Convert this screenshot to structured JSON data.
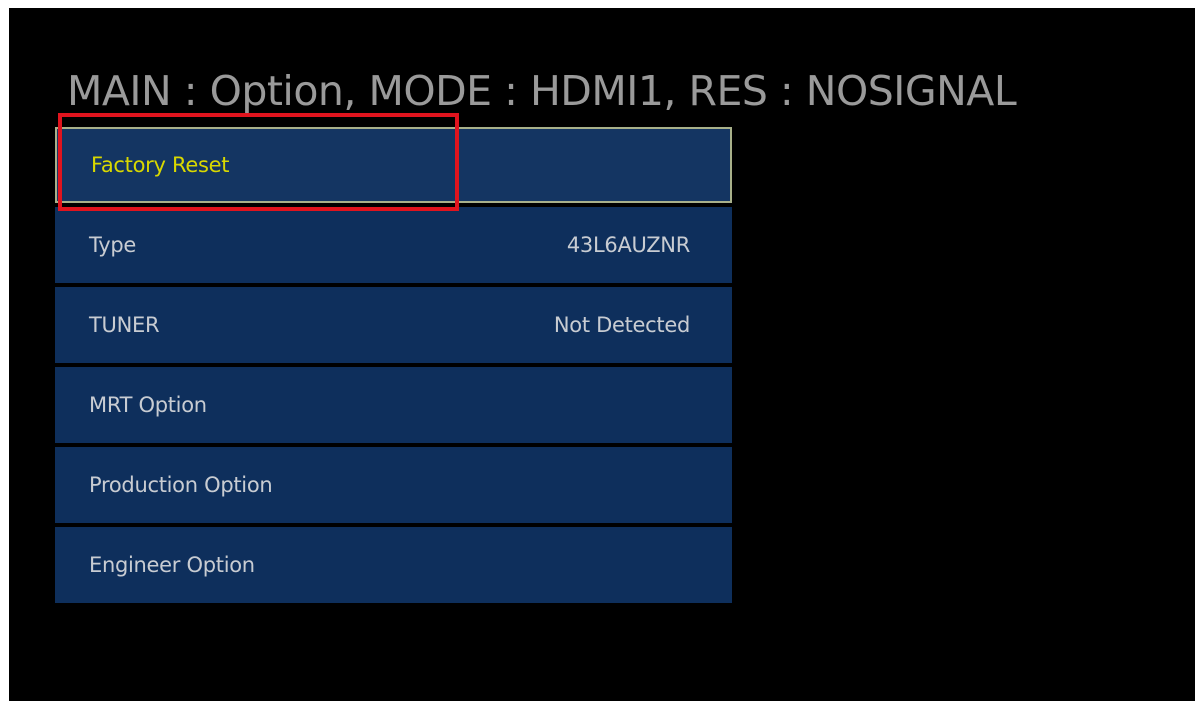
{
  "header": {
    "text": "MAIN : Option, MODE : HDMI1, RES : NOSIGNAL"
  },
  "menu": {
    "items": [
      {
        "label": "Factory Reset",
        "value": "",
        "selected": true
      },
      {
        "label": "Type",
        "value": "43L6AUZNR",
        "selected": false
      },
      {
        "label": "TUNER",
        "value": "Not Detected",
        "selected": false
      },
      {
        "label": "MRT Option",
        "value": "",
        "selected": false
      },
      {
        "label": "Production Option",
        "value": "",
        "selected": false
      },
      {
        "label": "Engineer Option",
        "value": "",
        "selected": false
      }
    ]
  },
  "colors": {
    "background": "#000000",
    "menu_item_bg": "#0e2f5c",
    "selected_text": "#d9d800",
    "highlight_annotation": "#e0141e"
  }
}
